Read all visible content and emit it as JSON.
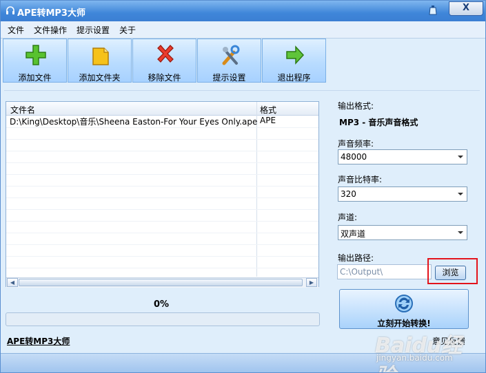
{
  "window": {
    "title": "APE转MP3大师",
    "close_label": "X"
  },
  "menu": [
    "文件",
    "文件操作",
    "提示设置",
    "关于"
  ],
  "toolbar": [
    {
      "label": "添加文件",
      "icon": "add-file-icon"
    },
    {
      "label": "添加文件夹",
      "icon": "add-folder-icon"
    },
    {
      "label": "移除文件",
      "icon": "remove-file-icon"
    },
    {
      "label": "提示设置",
      "icon": "settings-icon"
    },
    {
      "label": "退出程序",
      "icon": "exit-icon"
    }
  ],
  "file_list": {
    "columns": [
      "文件名",
      "格式"
    ],
    "rows": [
      {
        "name": "D:\\King\\Desktop\\音乐\\Sheena Easton-For Your Eyes Only.ape",
        "format": "APE"
      }
    ]
  },
  "progress": {
    "text": "0%",
    "value": 0
  },
  "app_link": "APE转MP3大师",
  "settings": {
    "format_label": "输出格式:",
    "format_value": "MP3 - 音乐声音格式",
    "sample_rate_label": "声音频率:",
    "sample_rate_value": "48000",
    "bitrate_label": "声音比特率:",
    "bitrate_value": "320",
    "channel_label": "声道:",
    "channel_value": "双声道",
    "output_label": "输出路径:",
    "output_value": "C:\\Output\\",
    "browse_label": "浏览",
    "start_label": "立刻开始转换!",
    "feedback_label": "意见反馈"
  },
  "watermark": {
    "logo": "Baidu经验",
    "url": "jingyan.baidu.com"
  },
  "colors": {
    "title_bar": "#3f86d9",
    "highlight": "#e3131b",
    "accent": "#4c9a2a"
  }
}
